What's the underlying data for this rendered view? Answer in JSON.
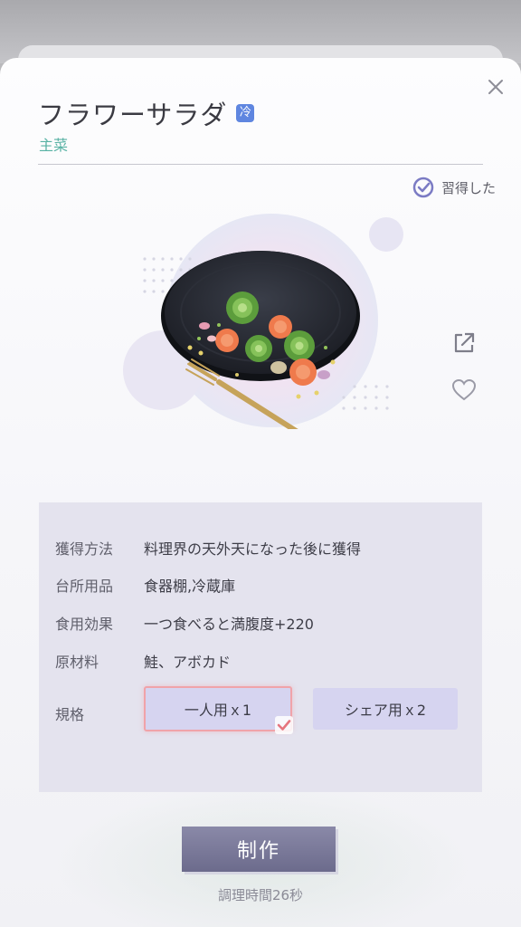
{
  "dish": {
    "name": "フラワーサラダ",
    "temperature_badge": "冷",
    "category": "主菜",
    "status_label": "習得した"
  },
  "info": {
    "rows": [
      {
        "label": "獲得方法",
        "value": "料理界の天外天になった後に獲得"
      },
      {
        "label": "台所用品",
        "value": "食器棚,冷蔵庫"
      },
      {
        "label": "食用効果",
        "value": "一つ食べると満腹度+220"
      },
      {
        "label": "原材料",
        "value": "鮭、アボカド"
      }
    ],
    "spec_label": "規格",
    "spec_options": [
      {
        "label": "一人用ｘ1",
        "selected": true
      },
      {
        "label": "シェア用ｘ2",
        "selected": false
      }
    ]
  },
  "actions": {
    "make_label": "制作",
    "cook_time": "調理時間26秒"
  },
  "icons": {
    "close": "close-icon",
    "learned": "check-circle-icon",
    "share": "share-icon",
    "favorite": "heart-icon"
  },
  "colors": {
    "category": "#58b2a4",
    "badge": "#5f86e0",
    "accent": "#7b7bc4",
    "selected_border": "#f0a3a9"
  }
}
